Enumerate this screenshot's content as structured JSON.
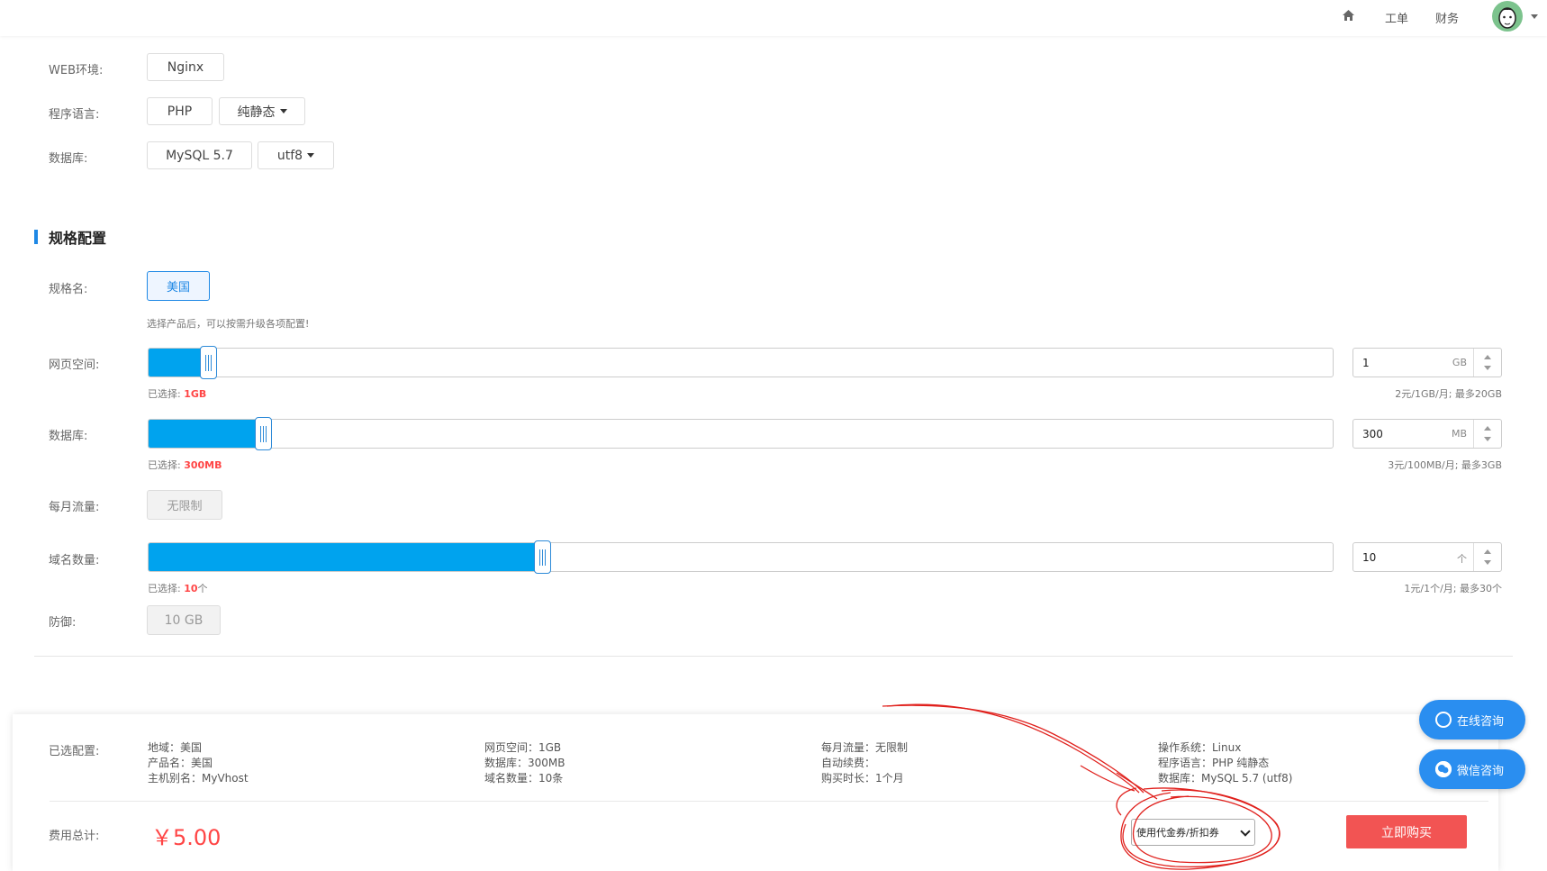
{
  "topbar": {
    "home_icon": "home-icon",
    "ticket": "工单",
    "finance": "财务"
  },
  "env": {
    "web_label": "WEB环境:",
    "web_value": "Nginx",
    "lang_label": "程序语言:",
    "lang_value": "PHP",
    "lang_option": "纯静态",
    "db_label": "数据库:",
    "db_value": "MySQL 5.7",
    "db_charset": "utf8"
  },
  "spec": {
    "section_title": "规格配置",
    "name_label": "规格名:",
    "name_value": "美国",
    "hint": "选择产品后，可以按需升级各项配置!",
    "space": {
      "label": "网页空间:",
      "selected_prefix": "已选择:",
      "selected": "1GB",
      "value": "1",
      "unit": "GB",
      "limit": "2元/1GB/月;  最多20GB",
      "fill_fraction": 0.05
    },
    "database": {
      "label": "数据库:",
      "selected_prefix": "已选择:",
      "selected": "300MB",
      "value": "300",
      "unit": "MB",
      "limit": "3元/100MB/月;  最多3GB",
      "fill_fraction": 0.1
    },
    "traffic": {
      "label": "每月流量:",
      "value": "无限制"
    },
    "domains": {
      "label": "域名数量:",
      "selected_prefix": "已选择:",
      "selected": "10",
      "selected_suffix": "个",
      "value": "10",
      "unit": "个",
      "limit": "1元/1个/月;  最多30个",
      "fill_fraction": 0.33
    },
    "defense": {
      "label": "防御:",
      "value": "10 GB"
    }
  },
  "summary": {
    "label": "已选配置:",
    "col1": [
      "地域：美国",
      "产品名：美国",
      "主机别名：MyVhost"
    ],
    "col2": [
      "网页空间：1GB",
      "数据库：300MB",
      "域名数量：10条"
    ],
    "col3": [
      "每月流量：无限制",
      "自动续费：",
      "购买时长：1个月"
    ],
    "col4": [
      "操作系统：Linux",
      "程序语言：PHP 纯静态",
      "数据库：MySQL 5.7 (utf8)"
    ],
    "total_label": "费用总计:",
    "price": "￥5.00",
    "coupon": "使用代金券/折扣券",
    "buy": "立即购买"
  },
  "consult": {
    "online": "在线咨询",
    "wechat": "微信咨询"
  },
  "colors": {
    "accent": "#00a3ee",
    "price": "#ff4545",
    "buy": "#f25453",
    "annotation": "#e0201c"
  }
}
